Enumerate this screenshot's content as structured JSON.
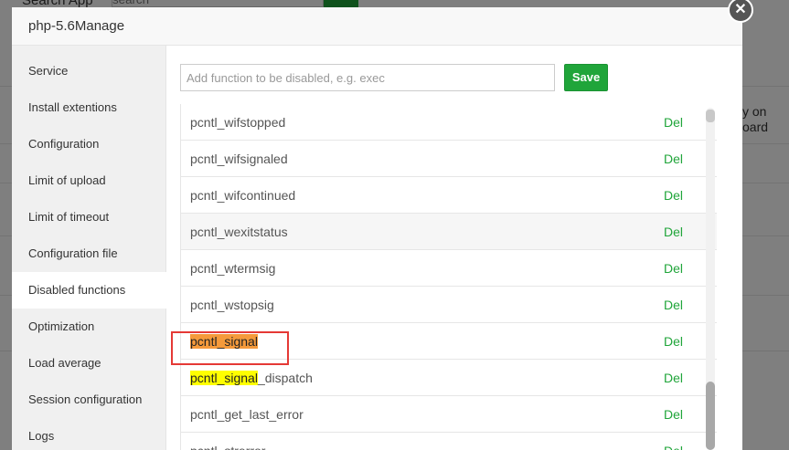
{
  "background": {
    "search_label": "Search App",
    "search_placeholder": "search",
    "right_text_line1": "y on",
    "right_text_line2": "oard"
  },
  "modal": {
    "title": "php-5.6Manage",
    "close_glyph": "✕"
  },
  "sidebar": {
    "items": [
      {
        "label": "Service"
      },
      {
        "label": "Install extentions"
      },
      {
        "label": "Configuration"
      },
      {
        "label": "Limit of upload"
      },
      {
        "label": "Limit of timeout"
      },
      {
        "label": "Configuration file"
      },
      {
        "label": "Disabled functions"
      },
      {
        "label": "Optimization"
      },
      {
        "label": "Load average"
      },
      {
        "label": "Session configuration"
      },
      {
        "label": "Logs"
      }
    ],
    "active": "Disabled functions"
  },
  "disabled_functions": {
    "input_placeholder": "Add function to be disabled, e.g. exec",
    "input_value": "",
    "save_label": "Save",
    "del_label": "Del",
    "rows": [
      {
        "name": "pcntl_wifstopped"
      },
      {
        "name": "pcntl_wifsignaled"
      },
      {
        "name": "pcntl_wifcontinued"
      },
      {
        "name": "pcntl_wexitstatus"
      },
      {
        "name": "pcntl_wtermsig"
      },
      {
        "name": "pcntl_wstopsig"
      },
      {
        "name_hl": "pcntl_signal",
        "name_rest": ""
      },
      {
        "name_hl": "pcntl_signal",
        "name_rest": "_dispatch"
      },
      {
        "name": "pcntl_get_last_error"
      },
      {
        "name": "pcntl_strerror"
      }
    ]
  },
  "colors": {
    "accent": "#20a53a",
    "highlight_orange": "#f59a3b",
    "highlight_yellow": "#ffff00",
    "annotation_red": "#e53935"
  }
}
